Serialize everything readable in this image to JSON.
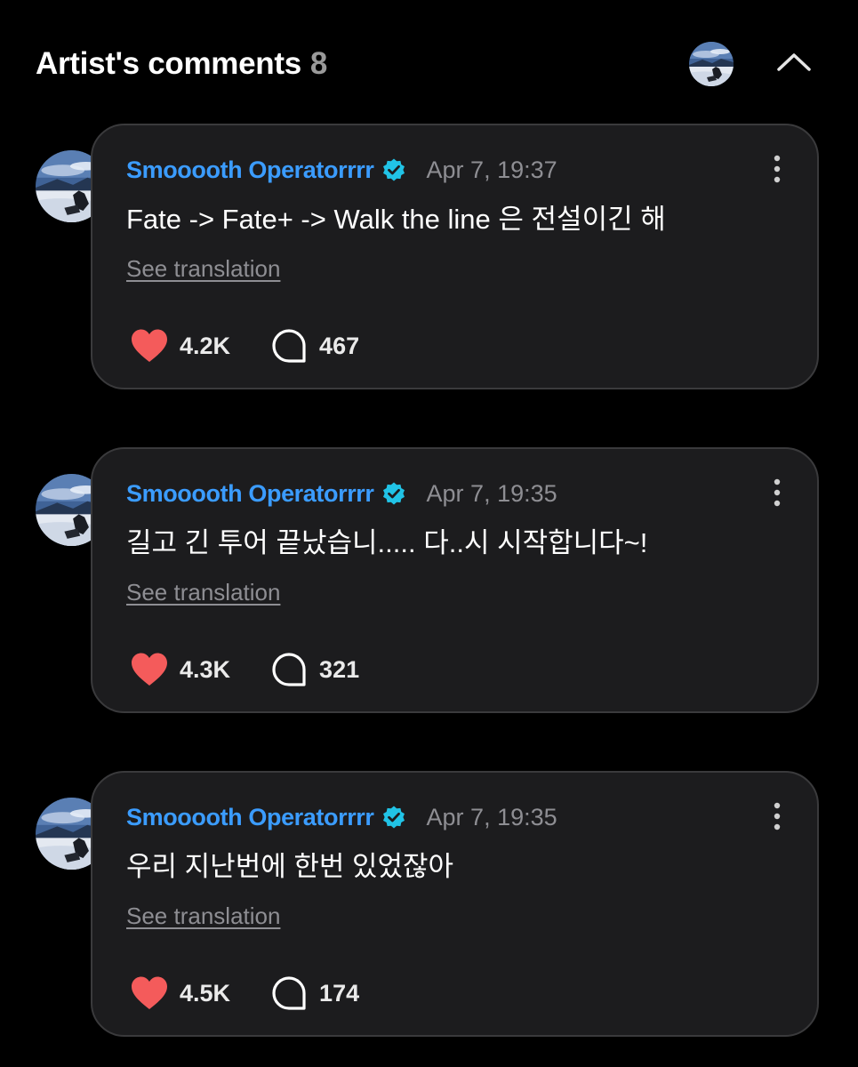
{
  "header": {
    "title": "Artist's comments",
    "count": "8",
    "avatar_icon": "profile-avatar",
    "collapse_icon": "chevron-up-icon"
  },
  "colors": {
    "background": "#000000",
    "card": "#1c1c1e",
    "card_border": "#3a3a3c",
    "author": "#3b9cff",
    "verified": "#21c3e6",
    "like": "#f45b5b",
    "muted": "#8e8e93"
  },
  "comments": [
    {
      "author": "Smooooth Operatorrrr",
      "verified": true,
      "timestamp": "Apr 7, 19:37",
      "text": "Fate -> Fate+ -> Walk the line 은 전설이긴 해",
      "translate_label": "See translation",
      "likes": "4.2K",
      "replies": "467"
    },
    {
      "author": "Smooooth Operatorrrr",
      "verified": true,
      "timestamp": "Apr 7, 19:35",
      "text": "길고 긴 투어 끝났습니..... 다..시 시작합니다~!",
      "translate_label": "See translation",
      "likes": "4.3K",
      "replies": "321"
    },
    {
      "author": "Smooooth Operatorrrr",
      "verified": true,
      "timestamp": "Apr 7, 19:35",
      "text": "우리 지난번에 한번 있었잖아",
      "translate_label": "See translation",
      "likes": "4.5K",
      "replies": "174"
    }
  ]
}
